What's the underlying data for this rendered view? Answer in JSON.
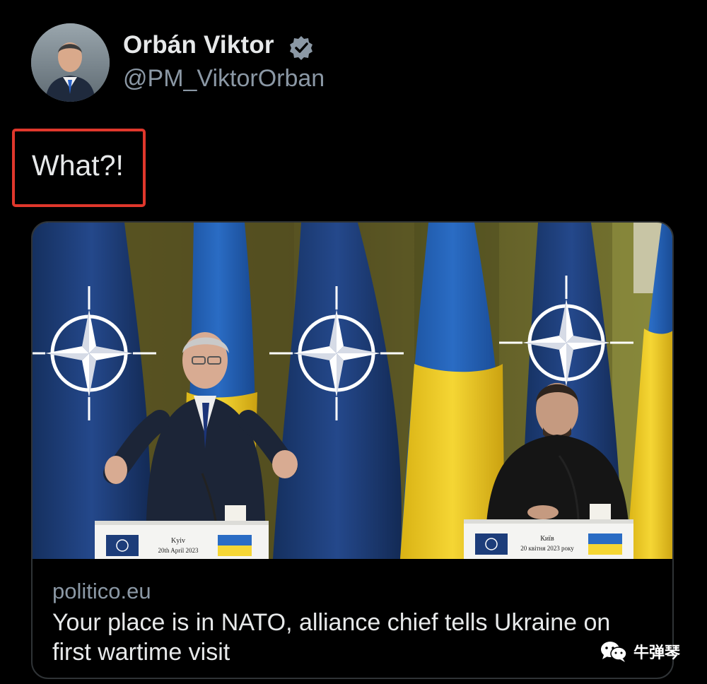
{
  "author": {
    "name": "Orbán Viktor",
    "handle": "@PM_ViktorOrban",
    "verified": true,
    "badge_color": "#8b98a5"
  },
  "tweet": {
    "text": "What?!",
    "highlight_color": "#e0372c"
  },
  "link_card": {
    "domain": "politico.eu",
    "title": "Your place is in NATO, alliance chief tells Ukraine on first wartime visit",
    "image": {
      "left_podium_text": [
        "Kyiv",
        "20th April 2023"
      ],
      "right_podium_text": [
        "Київ",
        "20 квітня 2023 року"
      ],
      "nato_flag_color": "#1d3d7a",
      "ukraine_blue": "#1f5fb3",
      "ukraine_yellow": "#f2cc1c"
    }
  },
  "watermark": {
    "text": "牛弹琴",
    "icon": "wechat-icon"
  }
}
